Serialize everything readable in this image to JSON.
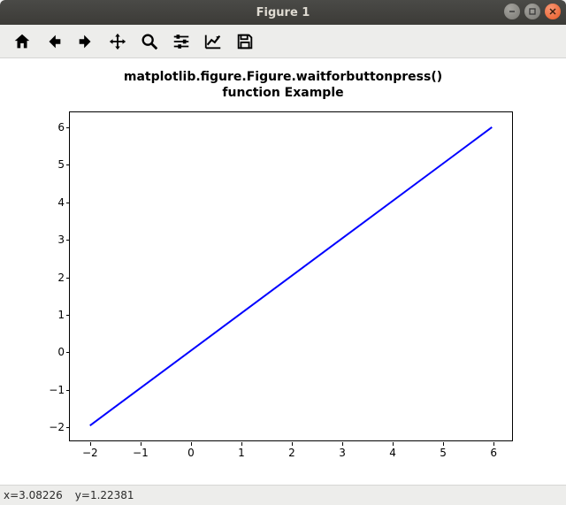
{
  "window": {
    "title": "Figure 1"
  },
  "toolbar": {
    "home": "Home",
    "back": "Back",
    "forward": "Forward",
    "pan": "Pan",
    "zoom": "Zoom",
    "subplots": "Configure subplots",
    "editaxes": "Edit axis",
    "save": "Save"
  },
  "status": {
    "x_label": "x=3.08226",
    "y_label": "y=1.22381"
  },
  "chart_data": {
    "type": "line",
    "title": "matplotlib.figure.Figure.waitforbuttonpress()\nfunction Example",
    "title_line1": "matplotlib.figure.Figure.waitforbuttonpress()",
    "title_line2": "function Example",
    "x": [
      -2,
      6
    ],
    "y": [
      -2,
      6
    ],
    "xlim": [
      -2.4,
      6.4
    ],
    "ylim": [
      -2.4,
      6.4
    ],
    "xticks": [
      -2,
      -1,
      0,
      1,
      2,
      3,
      4,
      5,
      6
    ],
    "yticks": [
      -2,
      -1,
      0,
      1,
      2,
      3,
      4,
      5,
      6
    ],
    "xlabel": "",
    "ylabel": "",
    "line_color": "#0000ff"
  },
  "ticks": {
    "x": {
      "m2": "−2",
      "m1": "−1",
      "0": "0",
      "1": "1",
      "2": "2",
      "3": "3",
      "4": "4",
      "5": "5",
      "6": "6"
    },
    "y": {
      "m2": "−2",
      "m1": "−1",
      "0": "0",
      "1": "1",
      "2": "2",
      "3": "3",
      "4": "4",
      "5": "5",
      "6": "6"
    }
  }
}
